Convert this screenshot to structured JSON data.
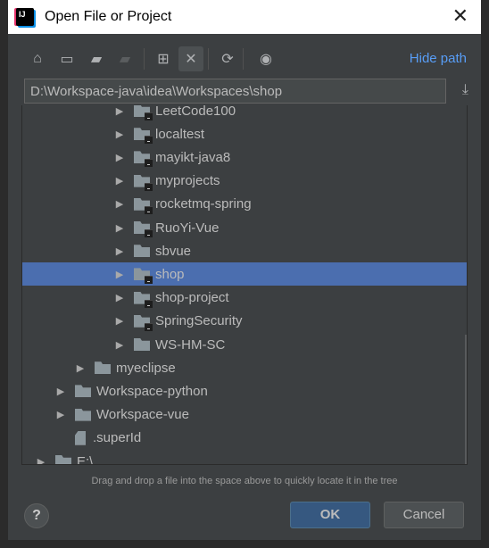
{
  "window": {
    "title": "Open File or Project",
    "app_icon_text": "IJ"
  },
  "toolbar": {
    "hide_path": "Hide path",
    "buttons": [
      "home",
      "desktop",
      "project-folder",
      "module-folder",
      "new-folder",
      "delete",
      "refresh",
      "show-hidden"
    ]
  },
  "path": {
    "value": "D:\\Workspace-java\\idea\\Workspaces\\shop"
  },
  "tree": [
    {
      "label": "LeetCode100",
      "depth": 4,
      "expandable": true,
      "module": true
    },
    {
      "label": "localtest",
      "depth": 4,
      "expandable": true,
      "module": true
    },
    {
      "label": "mayikt-java8",
      "depth": 4,
      "expandable": true,
      "module": true
    },
    {
      "label": "myprojects",
      "depth": 4,
      "expandable": true,
      "module": true
    },
    {
      "label": "rocketmq-spring",
      "depth": 4,
      "expandable": true,
      "module": true
    },
    {
      "label": "RuoYi-Vue",
      "depth": 4,
      "expandable": true,
      "module": true
    },
    {
      "label": "sbvue",
      "depth": 4,
      "expandable": true,
      "module": false
    },
    {
      "label": "shop",
      "depth": 4,
      "expandable": true,
      "module": true,
      "selected": true
    },
    {
      "label": "shop-project",
      "depth": 4,
      "expandable": true,
      "module": true
    },
    {
      "label": "SpringSecurity",
      "depth": 4,
      "expandable": true,
      "module": true
    },
    {
      "label": "WS-HM-SC",
      "depth": 4,
      "expandable": true,
      "module": false
    },
    {
      "label": "myeclipse",
      "depth": 2,
      "expandable": true,
      "module": false
    },
    {
      "label": "Workspace-python",
      "depth": 1,
      "expandable": true,
      "module": false
    },
    {
      "label": "Workspace-vue",
      "depth": 1,
      "expandable": true,
      "module": false
    },
    {
      "label": ".superId",
      "depth": 1,
      "expandable": false,
      "file": true
    },
    {
      "label": "E:\\",
      "depth": 0,
      "expandable": true,
      "module": false,
      "drive": true
    }
  ],
  "hint": "Drag and drop a file into the space above to quickly locate it in the tree",
  "buttons": {
    "help": "?",
    "ok": "OK",
    "cancel": "Cancel"
  },
  "colors": {
    "selection": "#4b6eaf",
    "link": "#589df6",
    "ok": "#365880"
  }
}
